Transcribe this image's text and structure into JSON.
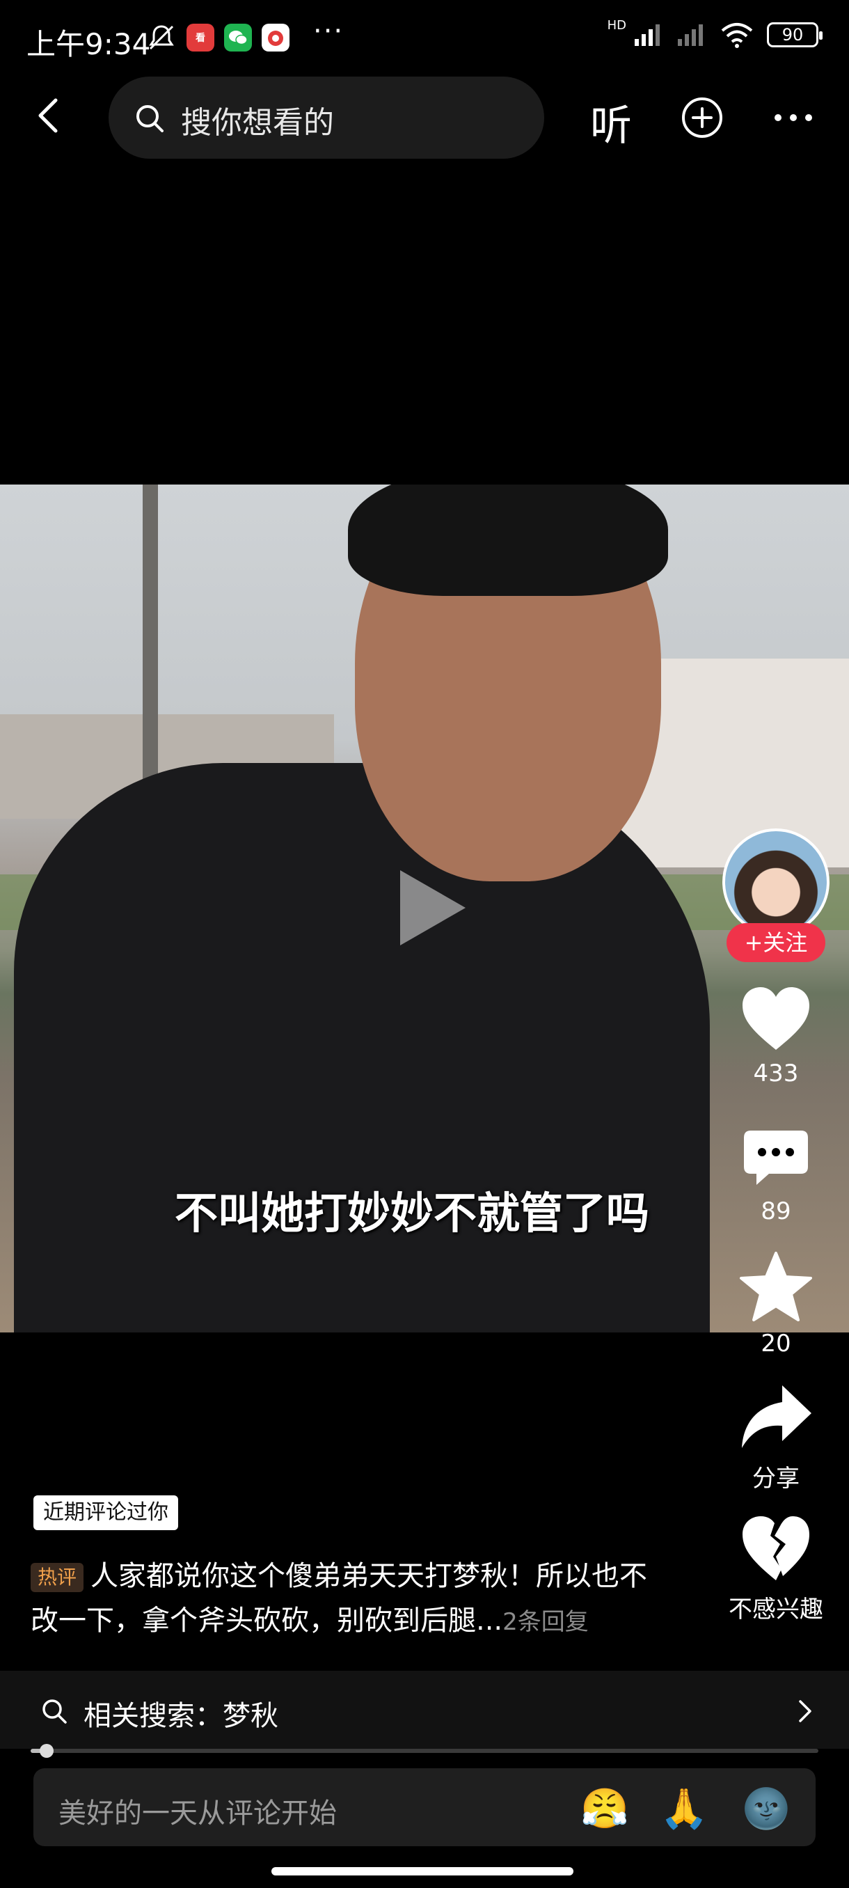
{
  "status_bar": {
    "time": "上午9:34",
    "battery": "90",
    "network": "HD",
    "icons": [
      "mute-bell-icon",
      "news-app-icon",
      "wechat-icon",
      "app-icon"
    ]
  },
  "top_nav": {
    "search_placeholder": "搜你想看的",
    "listen_label": "听"
  },
  "video": {
    "subtitle": "不叫她打妙妙不就管了吗"
  },
  "side_actions": {
    "follow_label": "+关注",
    "like_count": "433",
    "comment_count": "89",
    "favorite_count": "20",
    "share_label": "分享",
    "not_interested_label": "不感兴趣"
  },
  "comment": {
    "recent_tag": "近期评论过你",
    "hot_tag": "热评",
    "text": "人家都说你这个傻弟弟天天打梦秋！所以也不改一下，拿个斧头砍砍，别砍到后腿...",
    "reply_count": "2条回复"
  },
  "related_search": {
    "label": "相关搜索：梦秋"
  },
  "playback": {
    "progress": 0.02
  },
  "comment_input": {
    "placeholder": "美好的一天从评论开始",
    "emojis": [
      "😤",
      "🙏",
      "🌚"
    ]
  },
  "colors": {
    "follow_red": "#f0334a",
    "hot_orange": "#f0a04b",
    "background": "#000000"
  }
}
